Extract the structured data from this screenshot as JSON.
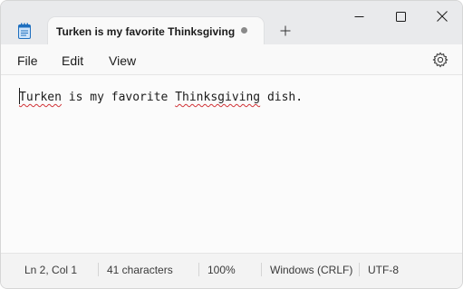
{
  "tab": {
    "title": "Turken is my favorite Thinksgiving"
  },
  "icons": {
    "app": "notepad-icon",
    "unsaved": "unsaved-dot-icon",
    "new_tab": "plus-icon",
    "minimize": "minimize-icon",
    "maximize": "maximize-icon",
    "close": "close-icon",
    "settings": "gear-icon"
  },
  "menu": {
    "file": "File",
    "edit": "Edit",
    "view": "View"
  },
  "editor": {
    "word1": "Turken",
    "part2": " is my favorite ",
    "word2": "Thinksgiving",
    "part3": " dish."
  },
  "status": {
    "position": "Ln 2, Col 1",
    "characters": "41 characters",
    "zoom": "100%",
    "line_ending": "Windows (CRLF)",
    "encoding": "UTF-8"
  },
  "colors": {
    "accent": "#1b1b1b",
    "spellcheck": "#d13438",
    "titlebar": "#e9eaec"
  }
}
